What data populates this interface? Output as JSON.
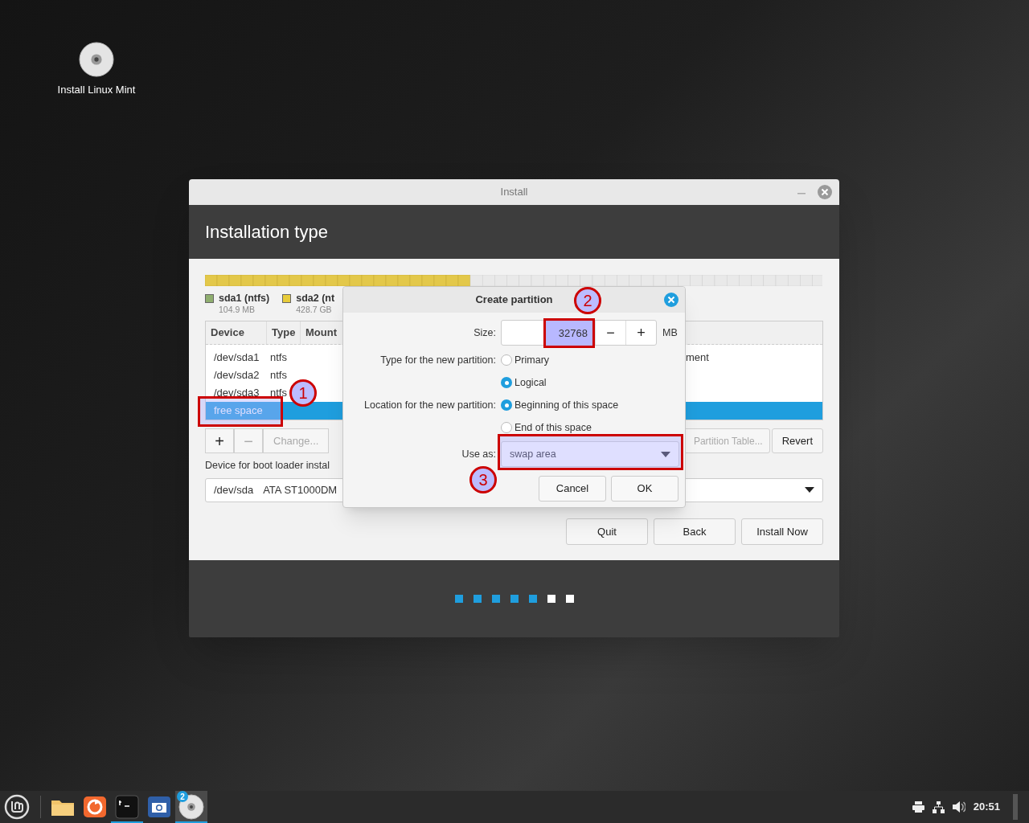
{
  "desktop": {
    "icons": [
      {
        "label": "Install Linux Mint"
      }
    ]
  },
  "window": {
    "title": "Install",
    "heading": "Installation type",
    "legend": [
      {
        "name": "sda1 (ntfs)",
        "size": "104.9 MB",
        "color": "#8fae6f"
      },
      {
        "name": "sda2 (nt",
        "size": "428.7 GB",
        "color": "#e8cc3a"
      }
    ],
    "table": {
      "columns": [
        "Device",
        "Type",
        "Mount"
      ],
      "rows": [
        {
          "device": "/dev/sda1",
          "type": "ntfs",
          "column_4": "ment",
          "selected": false
        },
        {
          "device": "/dev/sda2",
          "type": "ntfs",
          "selected": false
        },
        {
          "device": "/dev/sda3",
          "type": "ntfs",
          "selected": false
        },
        {
          "device": "free space",
          "selected": true
        }
      ]
    },
    "partition_buttons": [
      {
        "label": "+",
        "disabled": false
      },
      {
        "label": "−",
        "disabled": true
      },
      {
        "label": "Change...",
        "disabled": true
      }
    ],
    "table_buttons": [
      {
        "label": "Partition Table...",
        "disabled": true
      },
      {
        "label": "Revert",
        "disabled": false
      }
    ],
    "boot_loader": {
      "label": "Device for boot loader instal",
      "device": "/dev/sda",
      "model": "ATA ST1000DM"
    },
    "buttons": [
      "Quit",
      "Back",
      "Install Now"
    ],
    "progress_steps": [
      {
        "done": true
      },
      {
        "done": true
      },
      {
        "done": true
      },
      {
        "done": true
      },
      {
        "done": true
      },
      {
        "done": false
      },
      {
        "done": false
      }
    ]
  },
  "dialog": {
    "title": "Create partition",
    "size_label": "Size:",
    "size_value": "32768",
    "stepper": [
      "−",
      "+"
    ],
    "unit": "MB",
    "type_label": "Type for the new partition:",
    "type_options": [
      {
        "label": "Primary",
        "selected": false
      },
      {
        "label": "Logical",
        "selected": true
      }
    ],
    "location_label": "Location for the new partition:",
    "location_options": [
      {
        "label": "Beginning of this space",
        "selected": true
      },
      {
        "label": "End of this space",
        "selected": false
      }
    ],
    "use_as_label": "Use as:",
    "use_as_value": "swap area",
    "buttons": [
      "Cancel",
      "OK"
    ]
  },
  "annotations": [
    {
      "number": "1"
    },
    {
      "number": "2"
    },
    {
      "number": "3"
    }
  ],
  "taskbar": {
    "apps": [
      {
        "kind": "folder",
        "running": false,
        "focused": false
      },
      {
        "kind": "browser",
        "running": false,
        "focused": false
      },
      {
        "kind": "terminal",
        "running": true,
        "focused": false
      },
      {
        "kind": "camera",
        "running": false,
        "focused": false
      },
      {
        "kind": "disc",
        "running": true,
        "focused": true,
        "badge": "2"
      }
    ],
    "clock": "20:51"
  }
}
